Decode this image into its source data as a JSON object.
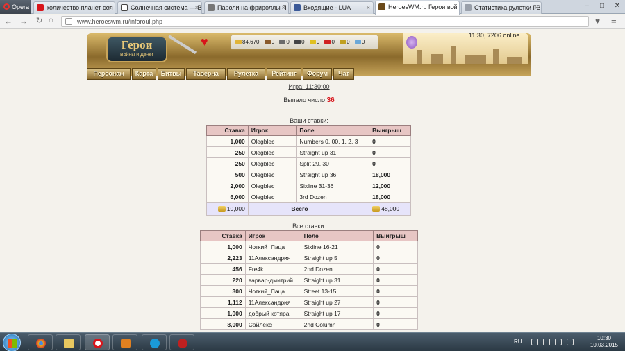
{
  "browser": {
    "app": "Opera",
    "tabs": [
      {
        "label": "количество планет сол",
        "color": "#d8141a"
      },
      {
        "label": "Солнечная система — В",
        "color": "#444444"
      },
      {
        "label": "Пароли на фрироллы П",
        "color": "#777777"
      },
      {
        "label": "Входящие - LUA",
        "color": "#3b5998"
      },
      {
        "label": "HeroesWM.ru Герои вой",
        "color": "#6b4a1a",
        "active": true
      },
      {
        "label": "Статистика рулетки ГВ",
        "color": "#9aa0aa"
      }
    ],
    "url": "www.heroeswm.ru/inforoul.php"
  },
  "site": {
    "logo_title": "Герои",
    "logo_sub": "Войны и Денег",
    "clock": "11:30, 7206 online",
    "resources": [
      {
        "icon": "gold-icon",
        "value": "84,670",
        "color": "#e0b438"
      },
      {
        "icon": "wood-icon",
        "value": "0",
        "color": "#8a5a2a"
      },
      {
        "icon": "ore-icon",
        "value": "0",
        "color": "#6c6c6c"
      },
      {
        "icon": "mercury-icon",
        "value": "0",
        "color": "#444444"
      },
      {
        "icon": "sulfur-icon",
        "value": "0",
        "color": "#e0c020"
      },
      {
        "icon": "crystal-icon",
        "value": "0",
        "color": "#d02020"
      },
      {
        "icon": "gem-icon",
        "value": "0",
        "color": "#c0a020"
      },
      {
        "icon": "diamond-icon",
        "value": "0",
        "color": "#6aa8d8"
      }
    ],
    "menu": [
      "Персонаж",
      "Карта",
      "Битвы",
      "Таверна",
      "Рулетка",
      "Рейтинг",
      "Форум",
      "Чат"
    ]
  },
  "roulette": {
    "game": "Игра: 11:30:00",
    "fell_label": "Выпало число",
    "fell_number": "36",
    "my_caption": "Ваши ставки:",
    "my_headers": [
      "Ставка",
      "Игрок",
      "Поле",
      "Выигрыш"
    ],
    "my_rows": [
      [
        "1,000",
        "Olegblec",
        "Numbers 0, 00, 1, 2, 3",
        "0"
      ],
      [
        "250",
        "Olegblec",
        "Straight up 31",
        "0"
      ],
      [
        "250",
        "Olegblec",
        "Split 29, 30",
        "0"
      ],
      [
        "500",
        "Olegblec",
        "Straight up 36",
        "18,000"
      ],
      [
        "2,000",
        "Olegblec",
        "Sixline 31-36",
        "12,000"
      ],
      [
        "6,000",
        "Olegblec",
        "3rd Dozen",
        "18,000"
      ]
    ],
    "my_total_bet": "10,000",
    "total_label": "Всего",
    "my_total_win": "48,000",
    "all_caption": "Все ставки:",
    "all_headers": [
      "Ставка",
      "Игрок",
      "Поле",
      "Выигрыш"
    ],
    "all_rows": [
      [
        "1,000",
        "Чоткий_Паца",
        "Sixline 16-21",
        "0"
      ],
      [
        "2,223",
        "11Александрия",
        "Straight up 5",
        "0"
      ],
      [
        "456",
        "Fre4k",
        "2nd Dozen",
        "0"
      ],
      [
        "220",
        "варвар-дмитрий",
        "Straight up 31",
        "0"
      ],
      [
        "300",
        "Чоткий_Паца",
        "Street 13-15",
        "0"
      ],
      [
        "1,112",
        "11Александрия",
        "Straight up 27",
        "0"
      ],
      [
        "1,000",
        "добрый котяра",
        "Straight up 17",
        "0"
      ],
      [
        "8,000",
        "Сайлекс",
        "2nd Column",
        "0"
      ]
    ]
  },
  "taskbar": {
    "lang": "RU",
    "time": "10:30",
    "date": "10.03.2015",
    "apps": [
      {
        "icon": "chrome-icon",
        "color": "#e0b020"
      },
      {
        "icon": "folder-icon",
        "color": "#e8c860"
      },
      {
        "icon": "opera-icon",
        "color": "#d8141a"
      },
      {
        "icon": "media-player-icon",
        "color": "#e08020"
      },
      {
        "icon": "skype-icon",
        "color": "#1a9ad8"
      },
      {
        "icon": "pokerstars-icon",
        "color": "#c02020"
      }
    ]
  }
}
